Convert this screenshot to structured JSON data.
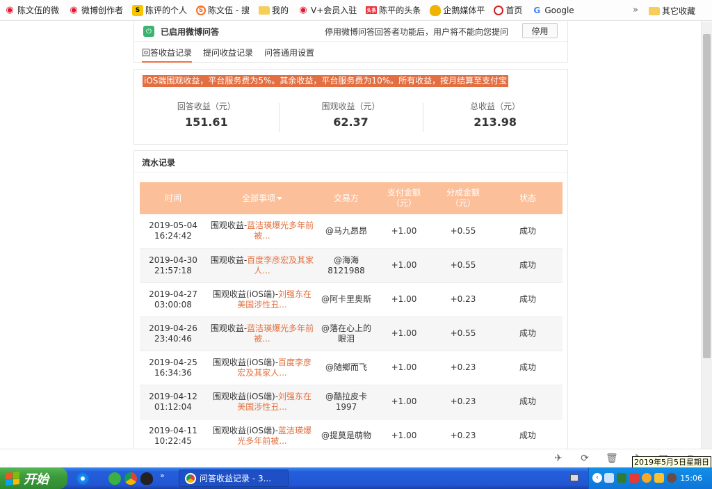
{
  "bookmarks": [
    {
      "label": "陈文伍的微",
      "icon": "weibo-icon"
    },
    {
      "label": "微博创作者",
      "icon": "weibo-icon"
    },
    {
      "label": "陈评的个人",
      "icon": "sohu-icon"
    },
    {
      "label": "陈文伍 - 搜",
      "icon": "sohu-circle-icon"
    },
    {
      "label": "我的",
      "icon": "folder-icon"
    },
    {
      "label": "V+会员入驻",
      "icon": "weibo-icon"
    },
    {
      "label": "陈平的头条",
      "icon": "toutiao-icon"
    },
    {
      "label": "企鹅媒体平",
      "icon": "penguin-icon"
    },
    {
      "label": "首页",
      "icon": "360-icon"
    },
    {
      "label": "Google",
      "icon": "google-icon"
    }
  ],
  "bookmarks_more": "»",
  "bookmarks_other": "其它收藏",
  "qa": {
    "enabled_label": "已启用微博问答",
    "stop_note": "停用微博问答回答者功能后，用户将不能向您提问",
    "stop_button": "停用"
  },
  "tabs": [
    "回答收益记录",
    "提问收益记录",
    "问答通用设置"
  ],
  "notice": "iOS端围观收益，平台服务费为5%。其余收益，平台服务费为10%。所有收益，按月结算至支付宝",
  "stats": [
    {
      "label": "回答收益（元）",
      "value": "151.61"
    },
    {
      "label": "围观收益（元）",
      "value": "62.37"
    },
    {
      "label": "总收益（元）",
      "value": "213.98"
    }
  ],
  "flow_title": "流水记录",
  "table": {
    "headers": {
      "time": "时间",
      "item": "全部事项",
      "party": "交易方",
      "pay": "支付金额（元）",
      "share": "分成金额（元）",
      "status": "状态"
    },
    "rows": [
      {
        "date": "2019-05-04",
        "clock": "16:24:42",
        "item_prefix": "围观收益-",
        "item_link": "蓝洁瑛爆光多年前被...",
        "party": "@马九昂昂",
        "pay": "+1.00",
        "share": "+0.55",
        "status": "成功"
      },
      {
        "date": "2019-04-30",
        "clock": "21:57:18",
        "item_prefix": "围观收益-",
        "item_link": "百度李彦宏及其家人...",
        "party": "@海海8121988",
        "pay": "+1.00",
        "share": "+0.55",
        "status": "成功"
      },
      {
        "date": "2019-04-27",
        "clock": "03:00:08",
        "item_prefix": "围观收益(iOS端)-",
        "item_link": "刘强东在美国涉性丑...",
        "party": "@阿卡里奥斯",
        "pay": "+1.00",
        "share": "+0.23",
        "status": "成功"
      },
      {
        "date": "2019-04-26",
        "clock": "23:40:46",
        "item_prefix": "围观收益-",
        "item_link": "蓝洁瑛爆光多年前被...",
        "party": "@落在心上的眼泪",
        "pay": "+1.00",
        "share": "+0.55",
        "status": "成功"
      },
      {
        "date": "2019-04-25",
        "clock": "16:34:36",
        "item_prefix": "围观收益(iOS端)-",
        "item_link": "百度李彦宏及其家人...",
        "party": "@随鄉而飞",
        "pay": "+1.00",
        "share": "+0.23",
        "status": "成功"
      },
      {
        "date": "2019-04-12",
        "clock": "01:12:04",
        "item_prefix": "围观收益(iOS端)-",
        "item_link": "刘强东在美国涉性丑...",
        "party": "@酷拉皮卡1997",
        "pay": "+1.00",
        "share": "+0.23",
        "status": "成功"
      },
      {
        "date": "2019-04-11",
        "clock": "10:22:45",
        "item_prefix": "围观收益(iOS端)-",
        "item_link": "蓝洁瑛爆光多年前被...",
        "party": "@提莫是萌物",
        "pay": "+1.00",
        "share": "+0.23",
        "status": "成功"
      }
    ]
  },
  "date_tooltip": "2019年5月5日星期日",
  "taskbar": {
    "start_label": "开始",
    "more": "»",
    "window_title": "问答收益记录 - 3...",
    "clock": "15:06"
  },
  "colors": {
    "accent": "#f26e3f",
    "table_header": "#fbbf9a",
    "positive": "#3d9b37"
  }
}
